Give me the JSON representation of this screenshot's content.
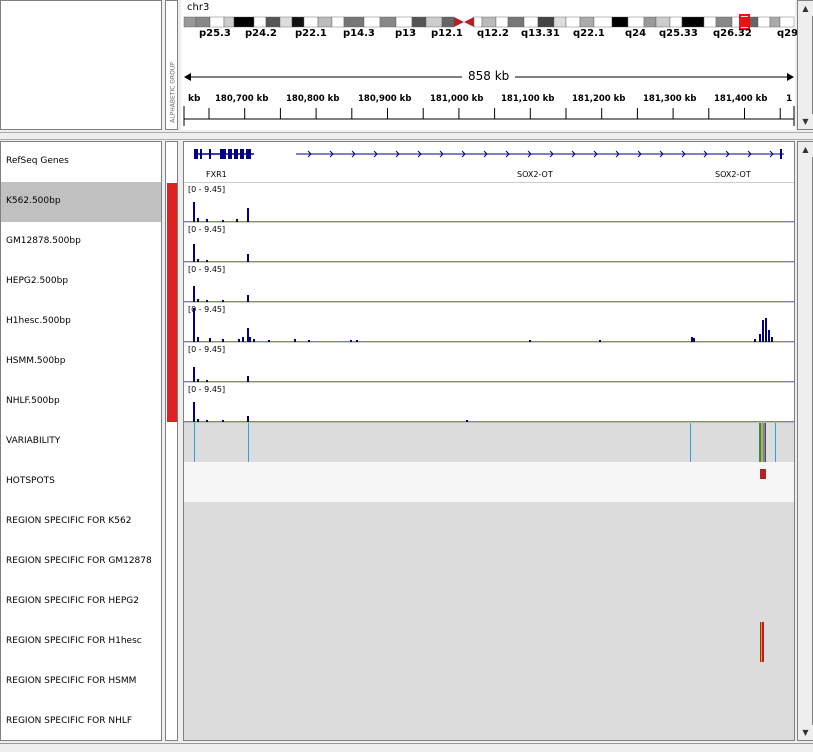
{
  "header": {
    "chromosome": "chr3",
    "span": "858 kb",
    "vertical_label": "ALPHABETIC GROUP"
  },
  "ideogram_bands": [
    "p25.3",
    "p24.2",
    "p22.1",
    "p14.3",
    "p13",
    "p12.1",
    "q12.2",
    "q13.31",
    "q22.1",
    "q24",
    "q25.33",
    "q26.32",
    "q29"
  ],
  "ruler": {
    "left_unit": "kb",
    "ticks": [
      "180,700 kb",
      "180,800 kb",
      "180,900 kb",
      "181,000 kb",
      "181,100 kb",
      "181,200 kb",
      "181,300 kb",
      "181,400 kb"
    ],
    "right_stub": "1"
  },
  "genes": {
    "track_name": "RefSeq Genes",
    "labels": [
      "FXR1",
      "SOX2-OT",
      "SOX2-OT"
    ]
  },
  "tracks": [
    {
      "name": "K562.500bp",
      "range": "[0 - 9.45]",
      "selected": true
    },
    {
      "name": "GM12878.500bp",
      "range": "[0 - 9.45]",
      "selected": false
    },
    {
      "name": "HEPG2.500bp",
      "range": "[0 - 9.45]",
      "selected": false
    },
    {
      "name": "H1hesc.500bp",
      "range": "[0 - 9.45]",
      "selected": false
    },
    {
      "name": "HSMM.500bp",
      "range": "[0 - 9.45]",
      "selected": false
    },
    {
      "name": "NHLF.500bp",
      "range": "[0 - 9.45]",
      "selected": false
    }
  ],
  "annotation_tracks": [
    "VARIABILITY",
    "HOTSPOTS",
    "REGION SPECIFIC FOR K562",
    "REGION SPECIFIC FOR GM12878",
    "REGION SPECIFIC FOR HEPG2",
    "REGION SPECIFIC FOR H1hesc",
    "REGION SPECIFIC FOR HSMM",
    "REGION SPECIFIC FOR NHLF"
  ],
  "colors": {
    "signal": "#00008b",
    "group_red": "#dd2222",
    "selected_row": "#c0c0c0",
    "variability_line": "#29a3e0",
    "hotspot": "#b22222",
    "region_bg": "#dcdcdc",
    "centromere": "#b22222",
    "ideogram_highlight": "#ee1111"
  },
  "scroll_icons": {
    "up": "scroll-up-arrow",
    "down": "scroll-down-arrow"
  }
}
